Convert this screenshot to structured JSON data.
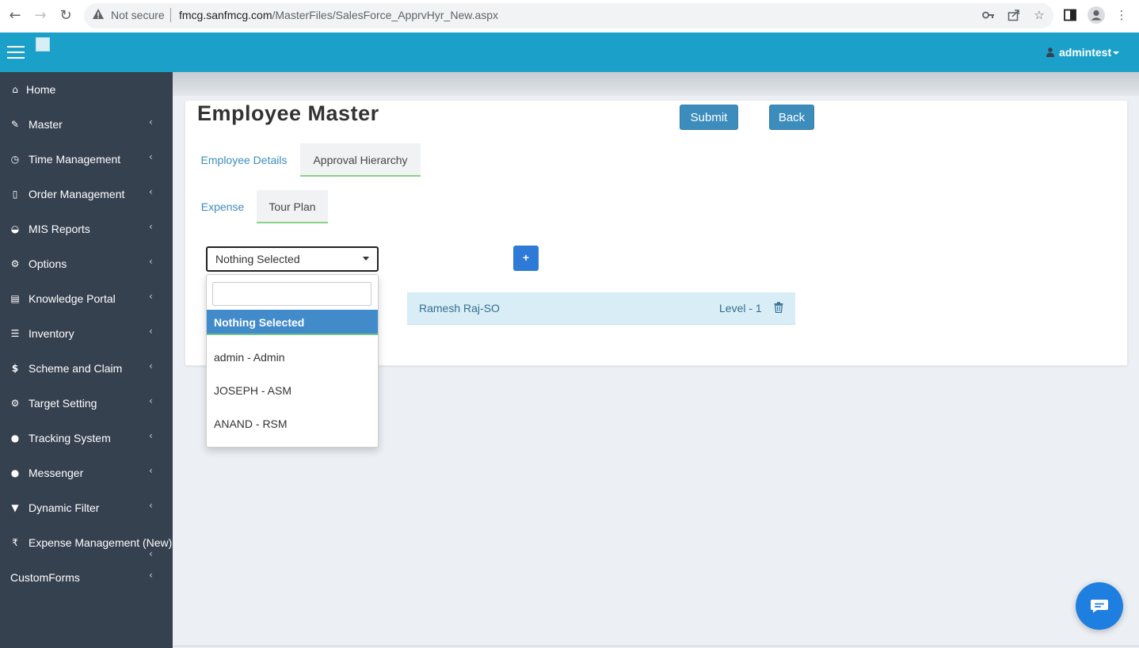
{
  "browser": {
    "not_secure": "Not secure",
    "url_host": "fmcg.sanfmcg.com",
    "url_path": "/MasterFiles/SalesForce_ApprvHyr_New.aspx"
  },
  "header": {
    "username": "admintest"
  },
  "sidebar": {
    "items": [
      {
        "label": "Home",
        "icon": "home-icon"
      },
      {
        "label": "Master",
        "icon": "gavel-icon"
      },
      {
        "label": "Time Management",
        "icon": "clock-icon"
      },
      {
        "label": "Order Management",
        "icon": "file-icon"
      },
      {
        "label": "MIS Reports",
        "icon": "dashboard-icon"
      },
      {
        "label": "Options",
        "icon": "cogs-icon"
      },
      {
        "label": "Knowledge Portal",
        "icon": "book-icon"
      },
      {
        "label": "Inventory",
        "icon": "list-alt-icon"
      },
      {
        "label": "Scheme and Claim",
        "icon": "dollar-icon"
      },
      {
        "label": "Target Setting",
        "icon": "gear-icon"
      },
      {
        "label": "Tracking System",
        "icon": "map-marker-icon"
      },
      {
        "label": "Messenger",
        "icon": "comments-icon"
      },
      {
        "label": "Dynamic Filter",
        "icon": "filter-icon"
      },
      {
        "label": "Expense Management (New)",
        "icon": "rupee-icon"
      },
      {
        "label": "CustomForms",
        "icon": ""
      }
    ]
  },
  "main": {
    "title": "Employee Master",
    "submit_label": "Submit",
    "back_label": "Back",
    "tabs": [
      {
        "label": "Employee Details",
        "active": false
      },
      {
        "label": "Approval Hierarchy",
        "active": true
      }
    ],
    "subtabs": [
      {
        "label": "Expense",
        "active": false
      },
      {
        "label": "Tour Plan",
        "active": true
      }
    ],
    "select": {
      "value": "Nothing Selected",
      "search_value": "",
      "options": [
        "Nothing Selected",
        "admin - Admin",
        "JOSEPH - ASM",
        "ANAND - RSM"
      ]
    },
    "add_label": "+",
    "hierarchy": [
      {
        "name": "Ramesh Raj-SO",
        "level": "Level - 1"
      }
    ]
  },
  "colors": {
    "header": "#1ba1c9",
    "sidebar": "#364150",
    "primary_button": "#3c8dbc",
    "add_button": "#2d7bd7",
    "selected_option": "#428bca",
    "hierarchy_row": "#d9edf7"
  }
}
